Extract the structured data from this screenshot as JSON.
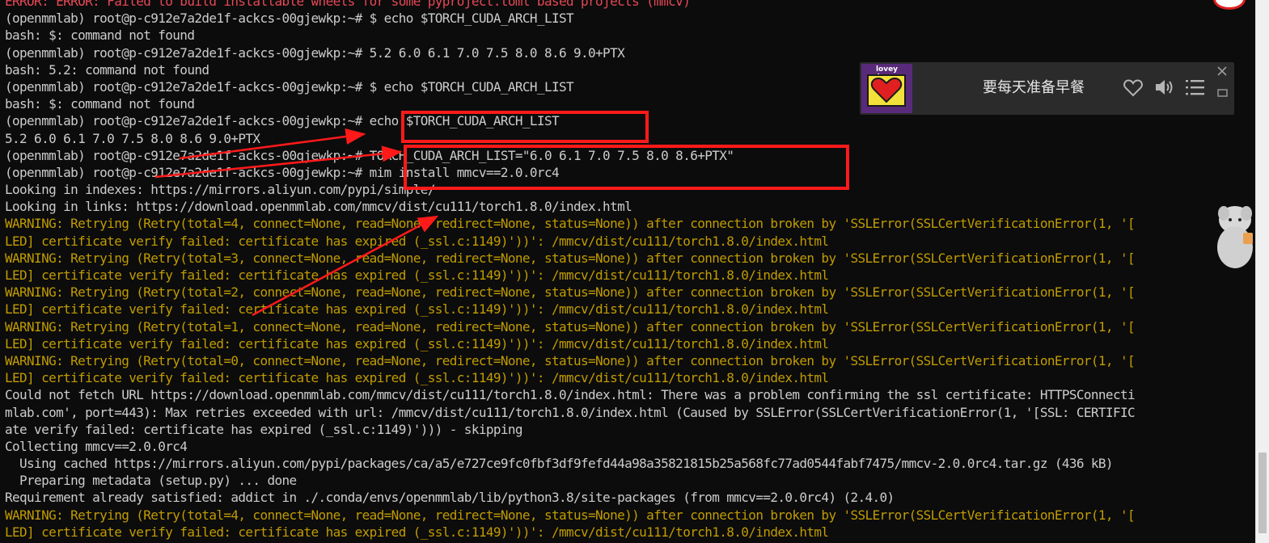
{
  "terminal": {
    "lines": [
      {
        "text": "ERROR: ERROR: Failed to build installable wheels for some pyproject.toml based projects (mmcv)",
        "color": "red"
      },
      {
        "text": "(openmmlab) root@p-c912e7a2de1f-ackcs-00gjewkp:~# $ echo $TORCH_CUDA_ARCH_LIST",
        "color": "white"
      },
      {
        "text": "bash: $: command not found",
        "color": "white"
      },
      {
        "text": "(openmmlab) root@p-c912e7a2de1f-ackcs-00gjewkp:~# 5.2 6.0 6.1 7.0 7.5 8.0 8.6 9.0+PTX",
        "color": "white"
      },
      {
        "text": "bash: 5.2: command not found",
        "color": "white"
      },
      {
        "text": "(openmmlab) root@p-c912e7a2de1f-ackcs-00gjewkp:~# $ echo $TORCH_CUDA_ARCH_LIST",
        "color": "white"
      },
      {
        "text": "bash: $: command not found",
        "color": "white"
      },
      {
        "text": "(openmmlab) root@p-c912e7a2de1f-ackcs-00gjewkp:~# echo $TORCH_CUDA_ARCH_LIST",
        "color": "white"
      },
      {
        "text": "5.2 6.0 6.1 7.0 7.5 8.0 8.6 9.0+PTX",
        "color": "white"
      },
      {
        "text": "(openmmlab) root@p-c912e7a2de1f-ackcs-00gjewkp:~# TORCH_CUDA_ARCH_LIST=\"6.0 6.1 7.0 7.5 8.0 8.6+PTX\"",
        "color": "white"
      },
      {
        "text": "(openmmlab) root@p-c912e7a2de1f-ackcs-00gjewkp:~# mim install mmcv==2.0.0rc4",
        "color": "white"
      },
      {
        "text": "Looking in indexes: https://mirrors.aliyun.com/pypi/simple/",
        "color": "white"
      },
      {
        "text": "Looking in links: https://download.openmmlab.com/mmcv/dist/cu111/torch1.8.0/index.html",
        "color": "white"
      },
      {
        "text": "WARNING: Retrying (Retry(total=4, connect=None, read=None, redirect=None, status=None)) after connection broken by 'SSLError(SSLCertVerificationError(1, '[",
        "color": "yellow"
      },
      {
        "text": "LED] certificate verify failed: certificate has expired (_ssl.c:1149)'))': /mmcv/dist/cu111/torch1.8.0/index.html",
        "color": "yellow"
      },
      {
        "text": "WARNING: Retrying (Retry(total=3, connect=None, read=None, redirect=None, status=None)) after connection broken by 'SSLError(SSLCertVerificationError(1, '[",
        "color": "yellow"
      },
      {
        "text": "LED] certificate verify failed: certificate has expired (_ssl.c:1149)'))': /mmcv/dist/cu111/torch1.8.0/index.html",
        "color": "yellow"
      },
      {
        "text": "WARNING: Retrying (Retry(total=2, connect=None, read=None, redirect=None, status=None)) after connection broken by 'SSLError(SSLCertVerificationError(1, '[",
        "color": "yellow"
      },
      {
        "text": "LED] certificate verify failed: certificate has expired (_ssl.c:1149)'))': /mmcv/dist/cu111/torch1.8.0/index.html",
        "color": "yellow"
      },
      {
        "text": "WARNING: Retrying (Retry(total=1, connect=None, read=None, redirect=None, status=None)) after connection broken by 'SSLError(SSLCertVerificationError(1, '[",
        "color": "yellow"
      },
      {
        "text": "LED] certificate verify failed: certificate has expired (_ssl.c:1149)'))': /mmcv/dist/cu111/torch1.8.0/index.html",
        "color": "yellow"
      },
      {
        "text": "WARNING: Retrying (Retry(total=0, connect=None, read=None, redirect=None, status=None)) after connection broken by 'SSLError(SSLCertVerificationError(1, '[",
        "color": "yellow"
      },
      {
        "text": "LED] certificate verify failed: certificate has expired (_ssl.c:1149)'))': /mmcv/dist/cu111/torch1.8.0/index.html",
        "color": "yellow"
      },
      {
        "text": "Could not fetch URL https://download.openmmlab.com/mmcv/dist/cu111/torch1.8.0/index.html: There was a problem confirming the ssl certificate: HTTPSConnecti",
        "color": "white"
      },
      {
        "text": "mlab.com', port=443): Max retries exceeded with url: /mmcv/dist/cu111/torch1.8.0/index.html (Caused by SSLError(SSLCertVerificationError(1, '[SSL: CERTIFIC",
        "color": "white"
      },
      {
        "text": "ate verify failed: certificate has expired (_ssl.c:1149)'))) - skipping",
        "color": "white"
      },
      {
        "text": "Collecting mmcv==2.0.0rc4",
        "color": "white"
      },
      {
        "text": "  Using cached https://mirrors.aliyun.com/pypi/packages/ca/a5/e727ce9fc0fbf3df9fefd44a98a35821815b25a568fc77ad0544fabf7475/mmcv-2.0.0rc4.tar.gz (436 kB)",
        "color": "white"
      },
      {
        "text": "  Preparing metadata (setup.py) ... done",
        "color": "white"
      },
      {
        "text": "Requirement already satisfied: addict in ./.conda/envs/openmmlab/lib/python3.8/site-packages (from mmcv==2.0.0rc4) (2.4.0)",
        "color": "white"
      },
      {
        "text": "WARNING: Retrying (Retry(total=4, connect=None, read=None, redirect=None, status=None)) after connection broken by 'SSLError(SSLCertVerificationError(1, '[",
        "color": "yellow"
      },
      {
        "text": "LED] certificate verify failed: certificate has expired (_ssl.c:1149)'))': /mmcv/dist/cu111/torch1.8.0/index.html",
        "color": "yellow"
      }
    ]
  },
  "colors": {
    "background": "#0c0c0c",
    "white": "#cccccc",
    "red": "#e74856",
    "yellow": "#c19c00",
    "annotation": "#ff1a1a"
  },
  "music_widget": {
    "song_title": "要每天准备早餐",
    "album_label": "lovey dovey",
    "icons": [
      "heart-icon",
      "volume-icon",
      "playlist-icon",
      "close-icon",
      "minimize-icon"
    ]
  }
}
